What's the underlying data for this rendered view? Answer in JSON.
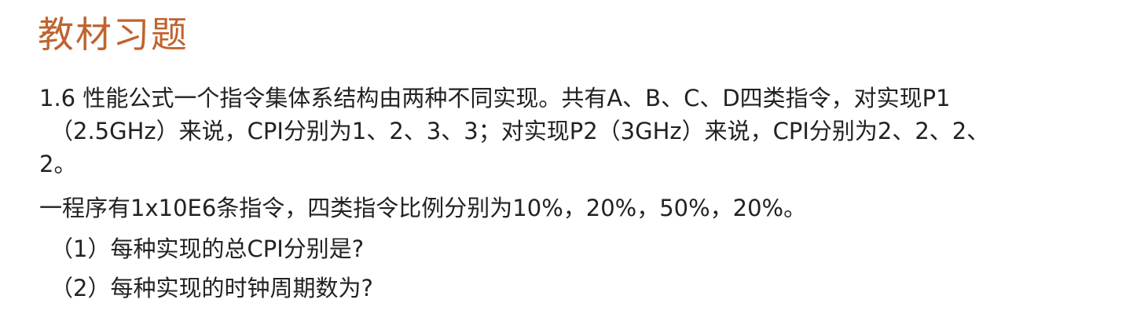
{
  "slide": {
    "title": "教材习题",
    "title_color": "#c0632e",
    "text_color": "#222222",
    "problem_lines": [
      "1.6 性能公式一个指令集体系结构由两种不同实现。共有A、B、C、D四类指令，对实现P1",
      "（2.5GHz）来说，CPI分别为1、2、3、3；对实现P2（3GHz）来说，CPI分别为2、2、2、",
      "2。"
    ],
    "program_info": "一程序有1x10E6条指令，四类指令比例分别为10%，20%，50%，20%。",
    "questions": [
      "（1）每种实现的总CPI分别是?",
      "（2）每种实现的时钟周期数为?"
    ]
  }
}
